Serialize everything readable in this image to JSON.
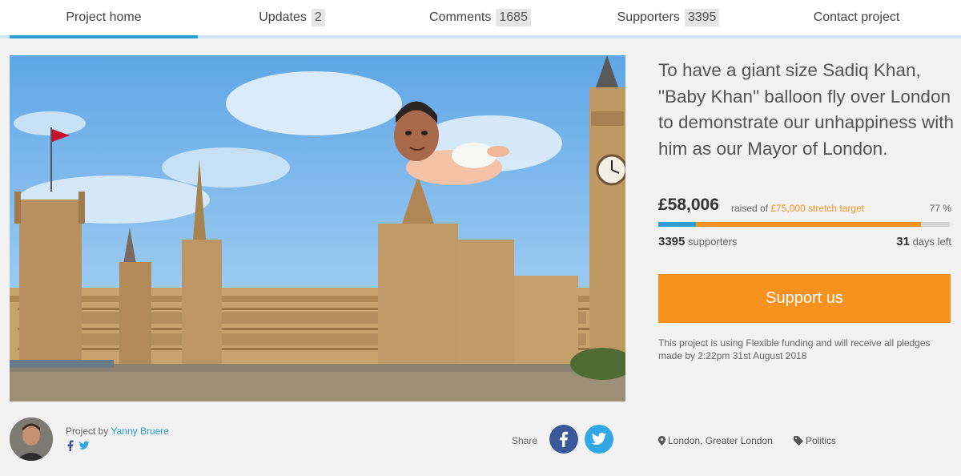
{
  "tabs": [
    {
      "label": "Project home",
      "count": null
    },
    {
      "label": "Updates",
      "count": "2"
    },
    {
      "label": "Comments",
      "count": "1685"
    },
    {
      "label": "Supporters",
      "count": "3395"
    },
    {
      "label": "Contact project",
      "count": null
    }
  ],
  "hero": {
    "image": "houses-of-parliament-with-baby-balloon"
  },
  "project": {
    "headline": "To have a giant size Sadiq Khan, \"Baby Khan\" balloon fly over London to demonstrate our unhappiness with him as our Mayor of London.",
    "amount": "£58,006",
    "raised_of": "raised of",
    "target": "£75,000 stretch target",
    "percent_label": "77 %",
    "progress": {
      "funded_fraction": 0.13,
      "stretch_fraction": 0.77
    },
    "supporters_count": "3395",
    "supporters_label": "supporters",
    "days_count": "31",
    "days_label": "days left",
    "support_button": "Support us",
    "funding_note": "This project is using Flexible funding and will receive all pledges made by 2:22pm 31st August 2018"
  },
  "creator": {
    "prefix": "Project by",
    "name": "Yanny Bruere"
  },
  "share": {
    "label": "Share"
  },
  "meta": {
    "location": "London, Greater London",
    "category": "Politics"
  },
  "colors": {
    "accent_blue": "#2c9fd6",
    "accent_orange": "#f7921e",
    "facebook": "#3b5998",
    "twitter": "#33a7e6"
  }
}
